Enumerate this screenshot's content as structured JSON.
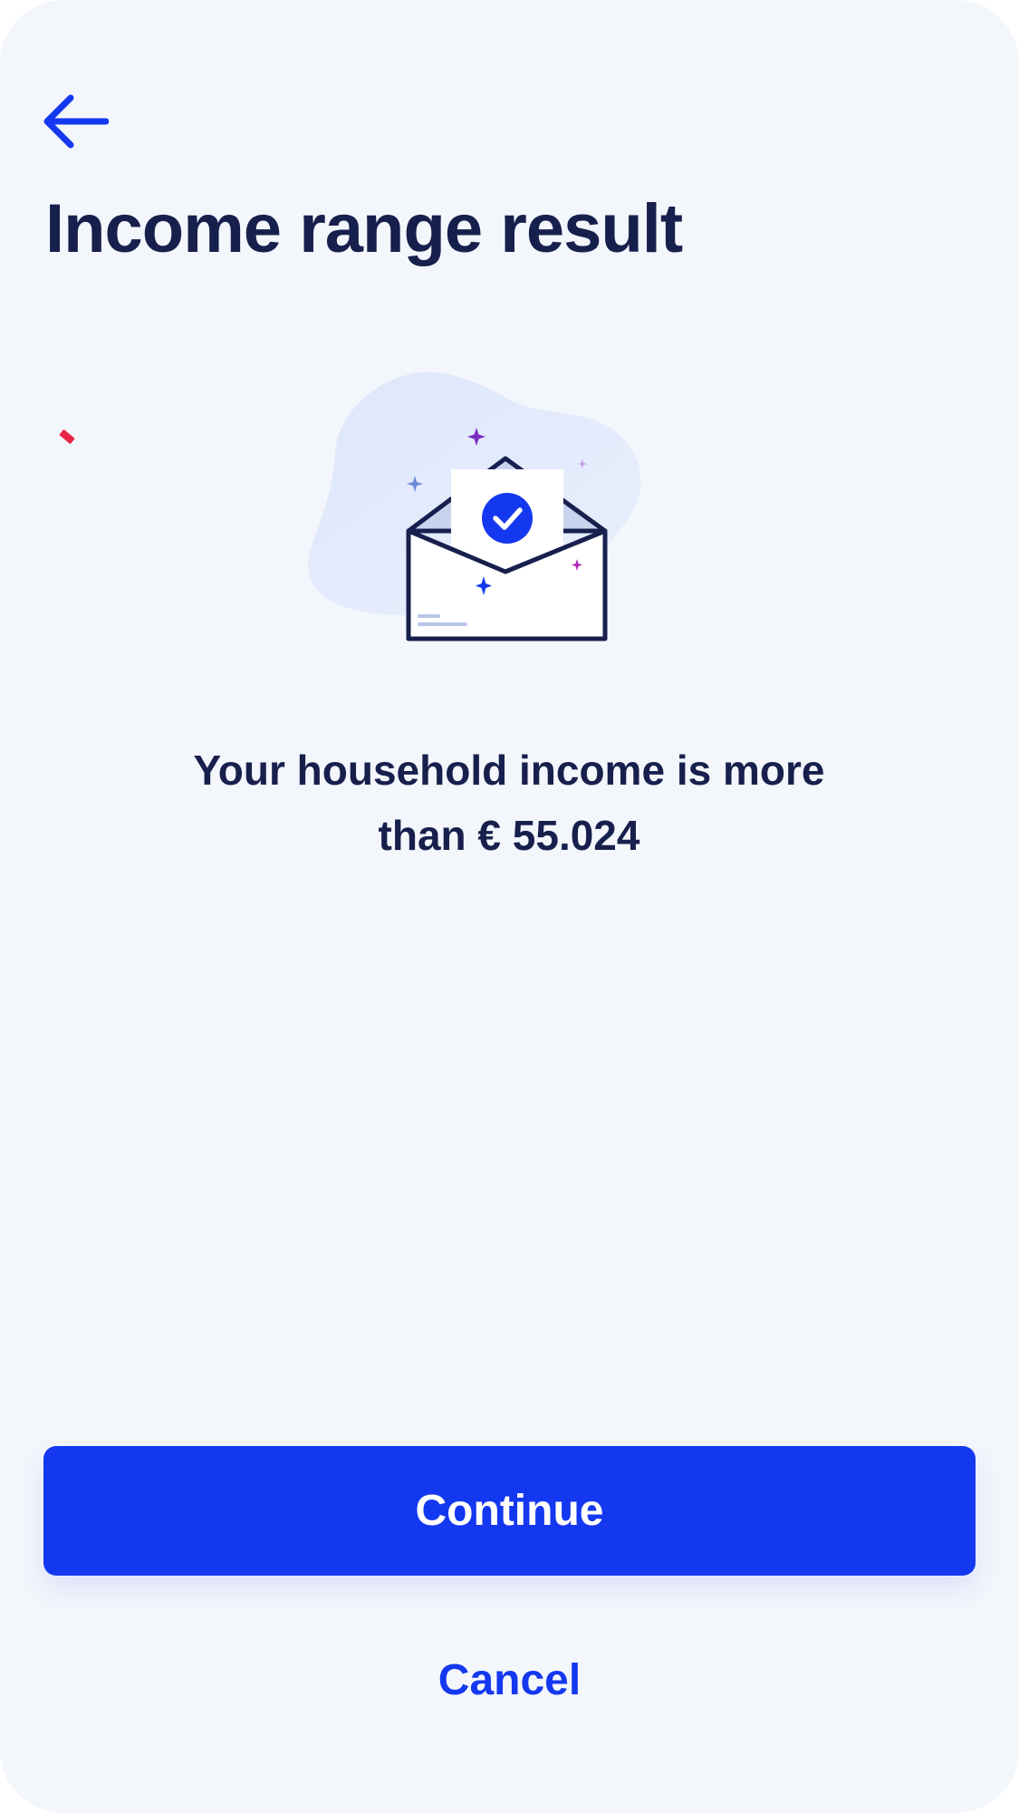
{
  "header": {
    "back_icon": "arrow-left-icon",
    "title": "Income range result"
  },
  "illustration": {
    "icon": "envelope-check-icon"
  },
  "result": {
    "line1": "Your household income is more",
    "line2": "than € 55.024"
  },
  "actions": {
    "continue_label": "Continue",
    "cancel_label": "Cancel"
  },
  "colors": {
    "background": "#f3f6fb",
    "primary": "#1438f0",
    "text": "#17204d",
    "confetti": "#e8264a"
  }
}
